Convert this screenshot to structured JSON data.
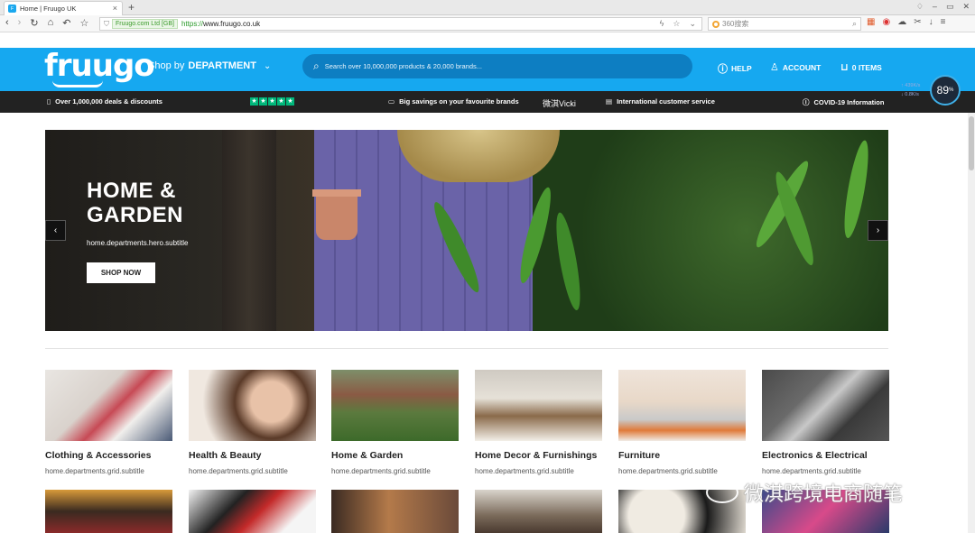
{
  "browser": {
    "tab_title": "Home | Fruugo UK",
    "tab_favicon": "F",
    "new_tab": "+",
    "cert_label": "Fruugo.com Ltd [GB]",
    "url_scheme": "https://",
    "url_host": "www.fruugo.co.uk",
    "search_placeholder": "360搜索"
  },
  "header": {
    "logo": "fruugo",
    "dept_prefix": "Shop by",
    "dept_label": "DEPARTMENT",
    "search_placeholder": "Search over 10,000,000 products & 20,000 brands...",
    "help": "HELP",
    "account": "ACCOUNT",
    "basket": "0 ITEMS",
    "brand_color": "#16a8f0"
  },
  "infobar": {
    "deals": "Over 1,000,000 deals & discounts",
    "savings": "Big savings on your favourite brands",
    "overlay_name": "微淇Vicki",
    "service": "International customer service",
    "covid": "COVID-19 Information",
    "speed_value": "89",
    "speed_unit": "%",
    "net_up": "439K/s",
    "net_down": "0.8K/s"
  },
  "hero": {
    "title_line1": "HOME &",
    "title_line2": "GARDEN",
    "subtitle": "home.departments.hero.subtitle",
    "cta": "SHOP NOW",
    "prev": "‹",
    "next": "›"
  },
  "grid": {
    "items": [
      {
        "name": "Clothing & Accessories",
        "sub": "home.departments.grid.subtitle"
      },
      {
        "name": "Health & Beauty",
        "sub": "home.departments.grid.subtitle"
      },
      {
        "name": "Home & Garden",
        "sub": "home.departments.grid.subtitle"
      },
      {
        "name": "Home Decor & Furnishings",
        "sub": "home.departments.grid.subtitle"
      },
      {
        "name": "Furniture",
        "sub": "home.departments.grid.subtitle"
      },
      {
        "name": "Electronics & Electrical",
        "sub": "home.departments.grid.subtitle"
      }
    ]
  },
  "watermark": "微淇跨境电商随笔"
}
